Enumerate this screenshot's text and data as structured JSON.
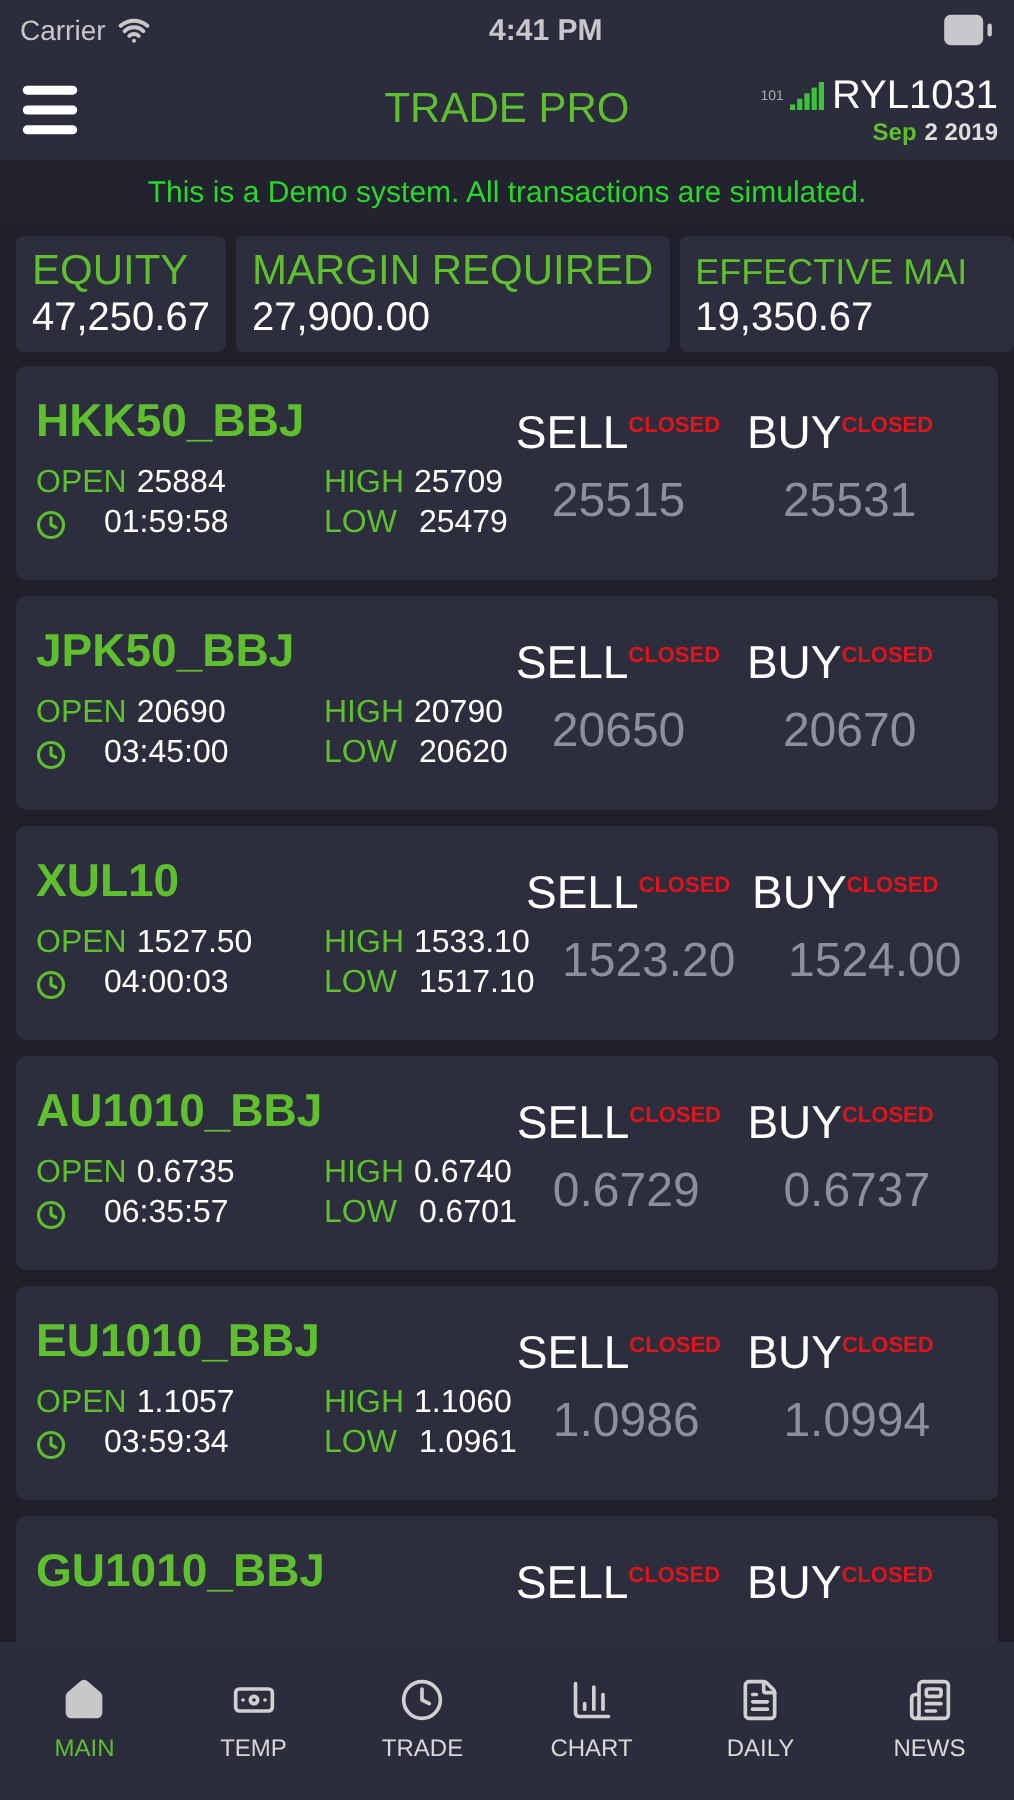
{
  "status_bar": {
    "carrier": "Carrier",
    "time": "4:41 PM"
  },
  "header": {
    "title": "TRADE PRO",
    "server": "101",
    "account": "RYL1031",
    "date_month": "Sep",
    "date_rest": "2 2019"
  },
  "banner": "This is a Demo system. All transactions are simulated.",
  "summary": [
    {
      "label": "EQUITY",
      "value": "47,250.67"
    },
    {
      "label": "MARGIN REQUIRED",
      "value": "27,900.00"
    },
    {
      "label": "EFFECTIVE MAI",
      "value": "19,350.67"
    }
  ],
  "quotes": [
    {
      "symbol": "HKK50_BBJ",
      "open_label": "OPEN",
      "open": "25884",
      "time": "01:59:58",
      "high_label": "HIGH",
      "high": "25709",
      "low_label": "LOW",
      "low": "25479",
      "sell_label": "SELL",
      "buy_label": "BUY",
      "sell_status": "CLOSED",
      "buy_status": "CLOSED",
      "sell": "25515",
      "buy": "25531"
    },
    {
      "symbol": "JPK50_BBJ",
      "open_label": "OPEN",
      "open": "20690",
      "time": "03:45:00",
      "high_label": "HIGH",
      "high": "20790",
      "low_label": "LOW",
      "low": "20620",
      "sell_label": "SELL",
      "buy_label": "BUY",
      "sell_status": "CLOSED",
      "buy_status": "CLOSED",
      "sell": "20650",
      "buy": "20670"
    },
    {
      "symbol": "XUL10",
      "open_label": "OPEN",
      "open": "1527.50",
      "time": "04:00:03",
      "high_label": "HIGH",
      "high": "1533.10",
      "low_label": "LOW",
      "low": "1517.10",
      "sell_label": "SELL",
      "buy_label": "BUY",
      "sell_status": "CLOSED",
      "buy_status": "CLOSED",
      "sell": "1523.20",
      "buy": "1524.00"
    },
    {
      "symbol": "AU1010_BBJ",
      "open_label": "OPEN",
      "open": "0.6735",
      "time": "06:35:57",
      "high_label": "HIGH",
      "high": "0.6740",
      "low_label": "LOW",
      "low": "0.6701",
      "sell_label": "SELL",
      "buy_label": "BUY",
      "sell_status": "CLOSED",
      "buy_status": "CLOSED",
      "sell": "0.6729",
      "buy": "0.6737"
    },
    {
      "symbol": "EU1010_BBJ",
      "open_label": "OPEN",
      "open": "1.1057",
      "time": "03:59:34",
      "high_label": "HIGH",
      "high": "1.1060",
      "low_label": "LOW",
      "low": "1.0961",
      "sell_label": "SELL",
      "buy_label": "BUY",
      "sell_status": "CLOSED",
      "buy_status": "CLOSED",
      "sell": "1.0986",
      "buy": "1.0994"
    },
    {
      "symbol": "GU1010_BBJ",
      "sell_label": "SELL",
      "buy_label": "BUY",
      "sell_status": "CLOSED",
      "buy_status": "CLOSED"
    }
  ],
  "tabs": [
    {
      "label": "MAIN",
      "kind": "home",
      "selected": true
    },
    {
      "label": "TEMP",
      "kind": "cash",
      "selected": false
    },
    {
      "label": "TRADE",
      "kind": "clock",
      "selected": false
    },
    {
      "label": "CHART",
      "kind": "chart",
      "selected": false
    },
    {
      "label": "DAILY",
      "kind": "doc",
      "selected": false
    },
    {
      "label": "NEWS",
      "kind": "news",
      "selected": false
    }
  ]
}
